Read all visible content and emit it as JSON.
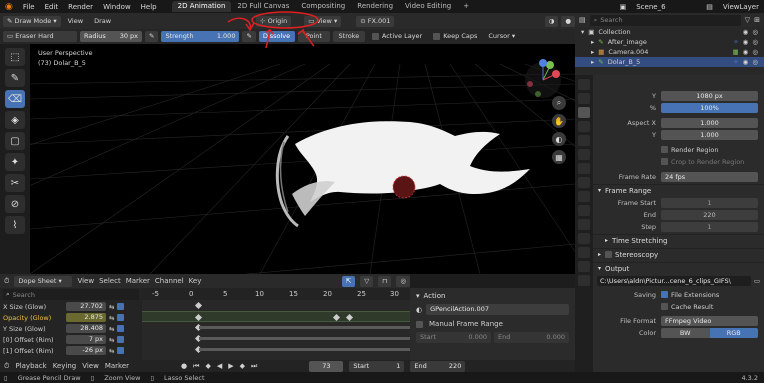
{
  "menubar": {
    "items": [
      "File",
      "Edit",
      "Render",
      "Window",
      "Help"
    ],
    "workspaces": [
      "2D Animation",
      "2D Full Canvas",
      "Compositing",
      "Rendering",
      "Video Editing"
    ],
    "scene": "Scene_6",
    "view_layer": "ViewLayer"
  },
  "header1": {
    "mode": "Draw Mode",
    "view": "View",
    "draw": "Draw",
    "origin": "Origin",
    "view_dropdown": "View",
    "fx": "FX.001"
  },
  "header2": {
    "tool": "Eraser Hard",
    "radius_label": "Radius",
    "radius_value": "30 px",
    "strength_label": "Strength",
    "strength_value": "1.000",
    "dissolve": "Dissolve",
    "point": "Point",
    "stroke": "Stroke",
    "active_layer": "Active Layer",
    "keep_caps": "Keep Caps",
    "cursor": "Cursor"
  },
  "viewport": {
    "overlay_line1": "User Perspective",
    "overlay_line2": "(73) Dolar_B_5"
  },
  "dopesheet": {
    "editor": "Dope Sheet",
    "menus": [
      "View",
      "Select",
      "Marker",
      "Channel",
      "Key"
    ],
    "search_placeholder": "Search",
    "channels": [
      {
        "name": "X Size (Glow)",
        "value": "27.702"
      },
      {
        "name": "Opacity (Glow)",
        "value": "2.875"
      },
      {
        "name": "Y Size (Glow)",
        "value": "28.408"
      },
      {
        "name": "[0] Offset (Rim)",
        "value": "7 px"
      },
      {
        "name": "[1] Offset (Rim)",
        "value": "-26 px"
      }
    ],
    "ruler": [
      "-5",
      "0",
      "5",
      "10",
      "15",
      "20",
      "25",
      "30"
    ],
    "current_frame": "73"
  },
  "action": {
    "title": "Action",
    "name": "GPencilAction.007",
    "manual_frame_range": "Manual Frame Range",
    "start_label": "Start",
    "start_value": "0.000",
    "end_label": "End",
    "end_value": "0.000"
  },
  "framebar": {
    "playback": "Playback",
    "keying": "Keying",
    "view": "View",
    "marker": "Marker",
    "frame": "73",
    "start_label": "Start",
    "start_value": "1",
    "end_label": "End",
    "end_value": "220"
  },
  "statusbar": {
    "items": [
      "Grease Pencil Draw",
      "Zoom View",
      "Lasso Select"
    ],
    "version": "4.3.2"
  },
  "outliner": {
    "search_placeholder": "Search",
    "items": [
      "Collection",
      "After_image",
      "Camera.004",
      "Dolar_B_5"
    ]
  },
  "properties": {
    "y_label": "Y",
    "y_value": "1080 px",
    "pct_label": "%",
    "pct_value": "100%",
    "aspect_label": "Aspect X",
    "aspect_x": "1.000",
    "aspect_y_label": "Y",
    "aspect_y": "1.000",
    "render_region": "Render Region",
    "crop_region": "Crop to Render Region",
    "frame_rate_label": "Frame Rate",
    "frame_rate": "24 fps",
    "frame_range": "Frame Range",
    "frame_start_label": "Frame Start",
    "frame_start": "1",
    "end_label": "End",
    "end_value": "220",
    "step_label": "Step",
    "step_value": "1",
    "time_stretching": "Time Stretching",
    "stereoscopy": "Stereoscopy",
    "output": "Output",
    "output_path": "C:\\Users\\aldn\\Pictur...cene_6_clips_GIFS\\",
    "saving_label": "Saving",
    "file_extensions": "File Extensions",
    "cache_result": "Cache Result",
    "file_format_label": "File Format",
    "file_format": "FFmpeg Video",
    "color_label": "Color",
    "color_bw": "BW",
    "color_rgb": "RGB"
  },
  "colors": {
    "accent": "#4772b3",
    "annotation": "#e02020"
  }
}
